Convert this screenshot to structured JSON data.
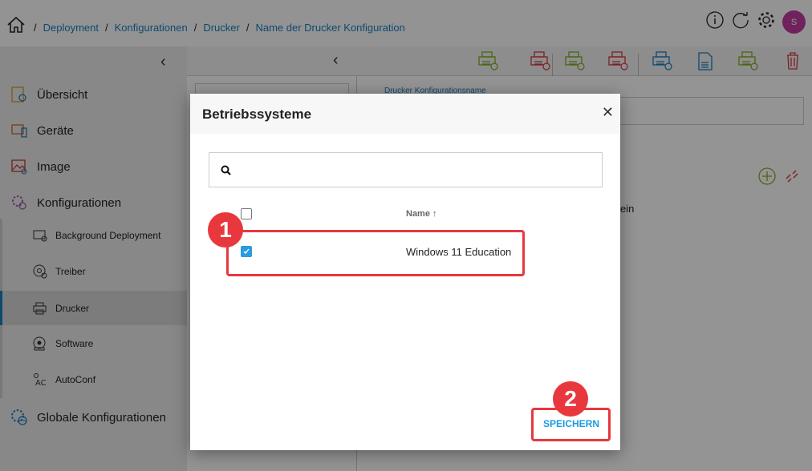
{
  "breadcrumb": {
    "items": [
      "Deployment",
      "Konfigurationen",
      "Drucker",
      "Name der Drucker Konfiguration"
    ]
  },
  "header": {
    "avatar_initial": "S",
    "icons": [
      "info-icon",
      "refresh-icon",
      "gear-icon"
    ]
  },
  "sidebar": {
    "items": [
      {
        "label": "Übersicht",
        "icon": "overview-icon"
      },
      {
        "label": "Geräte",
        "icon": "devices-icon"
      },
      {
        "label": "Image",
        "icon": "image-icon"
      },
      {
        "label": "Konfigurationen",
        "icon": "configurations-icon"
      }
    ],
    "sub_items": [
      {
        "label": "Background Deployment",
        "icon": "background-deployment-icon"
      },
      {
        "label": "Treiber",
        "icon": "driver-icon"
      },
      {
        "label": "Drucker",
        "icon": "printer-icon",
        "active": true
      },
      {
        "label": "Software",
        "icon": "software-icon"
      },
      {
        "label": "AutoConf",
        "icon": "autoconf-icon"
      }
    ],
    "global": {
      "label": "Globale Konfigurationen",
      "icon": "global-config-icon"
    }
  },
  "toolbar": {
    "icons": [
      {
        "name": "add-driver-icon",
        "color": "#7fae1e"
      },
      {
        "name": "remove-driver-icon",
        "color": "#d9363e"
      },
      {
        "name": "add-printer-icon",
        "color": "#7fae1e"
      },
      {
        "name": "remove-printer-icon",
        "color": "#d9363e"
      },
      {
        "name": "printer-sync-icon",
        "color": "#1a7fc0"
      },
      {
        "name": "document-icon",
        "color": "#1a7fc0"
      },
      {
        "name": "printer-settings-icon",
        "color": "#7fae1e"
      },
      {
        "name": "trash-icon",
        "color": "#d9363e"
      }
    ]
  },
  "detail": {
    "name_label": "Drucker Konfigurationsname",
    "partial_text": "ein"
  },
  "modal": {
    "title": "Betriebssysteme",
    "search_placeholder": "",
    "column_name": "Name",
    "sort": "ascending",
    "rows": [
      {
        "name": "Windows 11 Education",
        "checked": true
      }
    ],
    "select_all_checked": false,
    "save_label": "SPEICHERN"
  },
  "annotations": {
    "step1": "1",
    "step2": "2",
    "color": "#e8383d"
  },
  "colors": {
    "accent": "#1a7fc0",
    "checkbox": "#2a9be0"
  }
}
